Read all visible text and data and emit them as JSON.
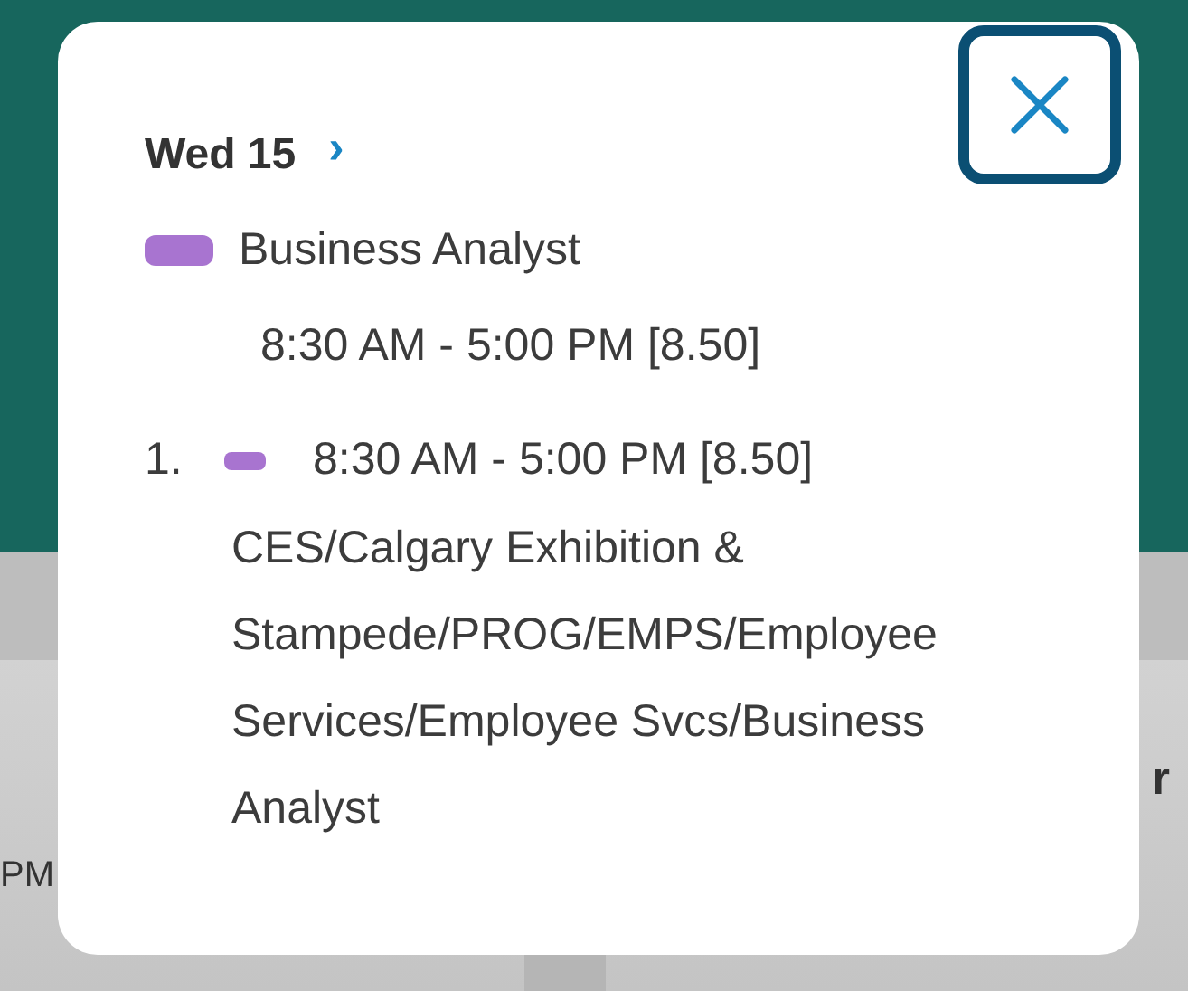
{
  "background": {
    "left_cell_text": "PM",
    "right_cell_text": "r"
  },
  "popup": {
    "date": "Wed 15",
    "next": "›",
    "position": {
      "title": "Business Analyst",
      "color": "#a874d0",
      "time": "8:30 AM - 5:00 PM [8.50]"
    },
    "shifts": [
      {
        "number": "1.",
        "color": "#a874d0",
        "time": "8:30 AM - 5:00 PM [8.50]",
        "path": "CES/Calgary Exhibition & Stampede/PROG/EMPS/Employee Services/Employee Svcs/Business Analyst"
      }
    ]
  }
}
